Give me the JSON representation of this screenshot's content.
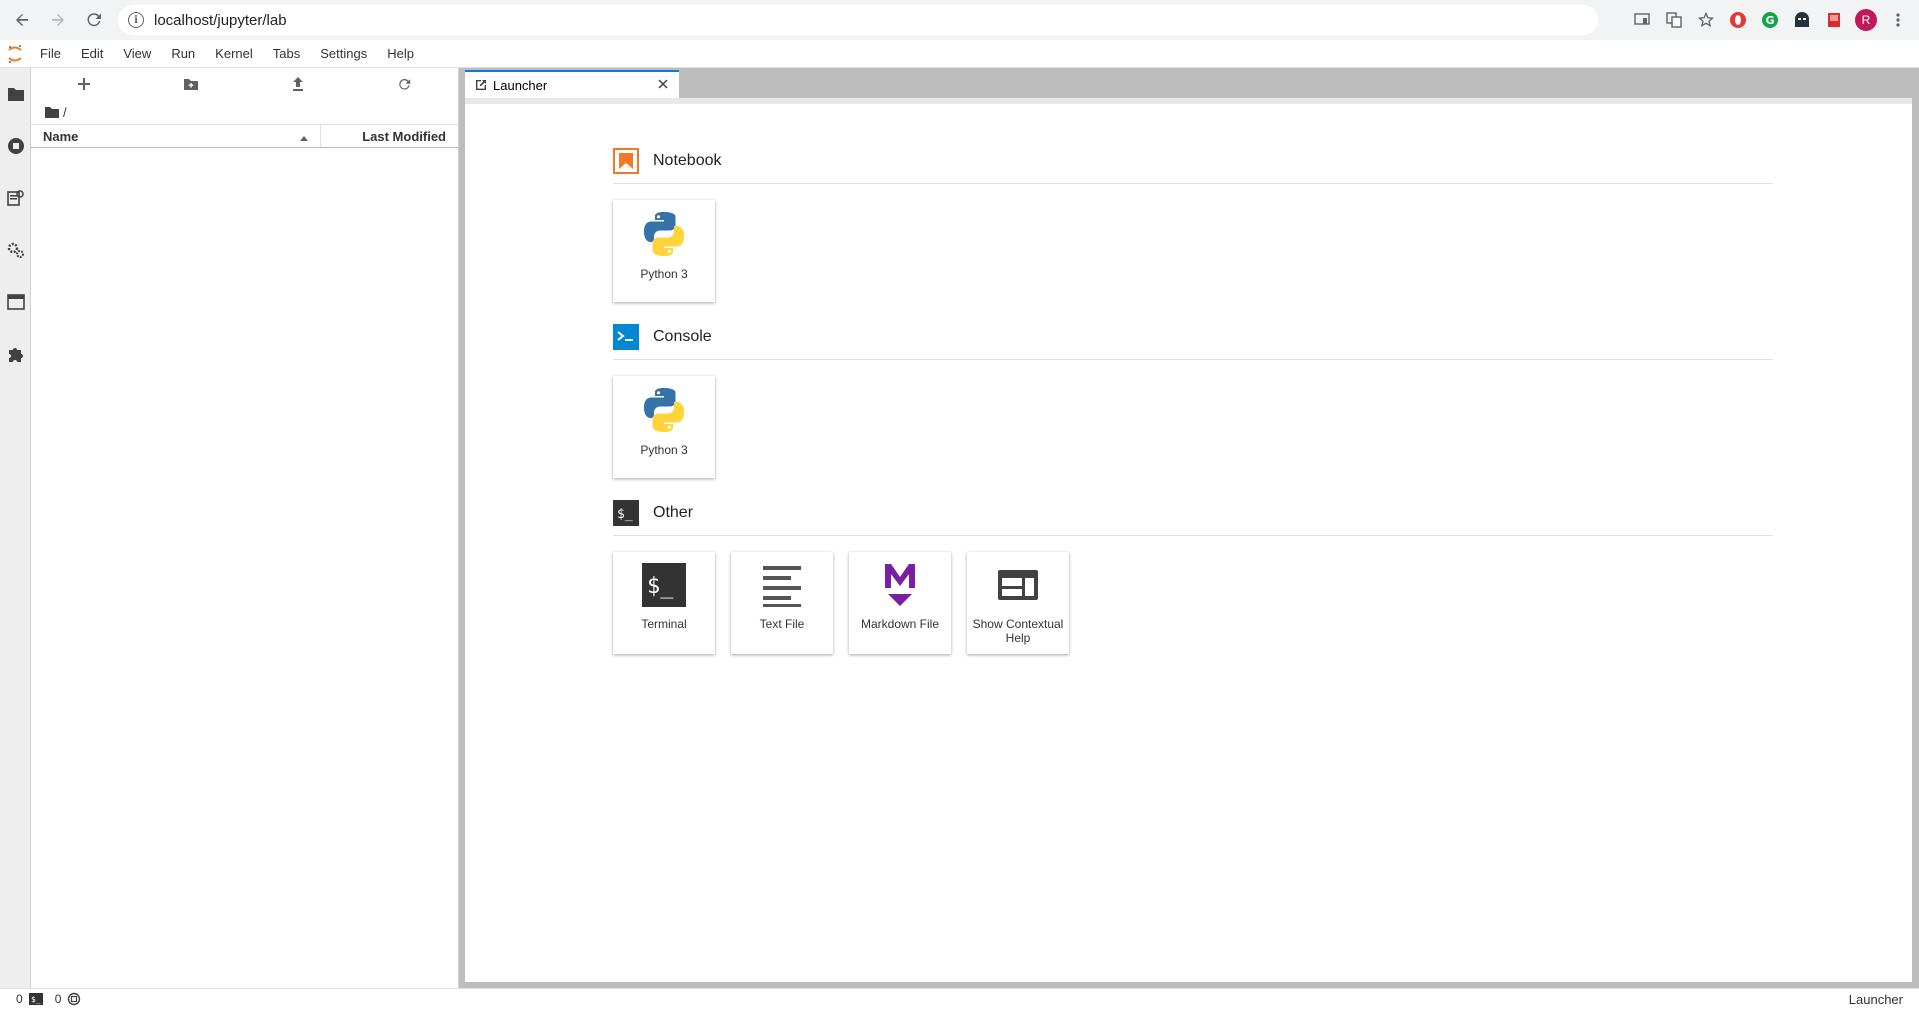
{
  "browser": {
    "url": "localhost/jupyter/lab",
    "avatar_letter": "R"
  },
  "menu": {
    "items": [
      "File",
      "Edit",
      "View",
      "Run",
      "Kernel",
      "Tabs",
      "Settings",
      "Help"
    ]
  },
  "filebrowser": {
    "breadcrumb": "/",
    "col_name": "Name",
    "col_modified": "Last Modified"
  },
  "tabs": [
    {
      "label": "Launcher"
    }
  ],
  "launcher": {
    "sections": [
      {
        "title": "Notebook",
        "cards": [
          {
            "label": "Python 3"
          }
        ]
      },
      {
        "title": "Console",
        "cards": [
          {
            "label": "Python 3"
          }
        ]
      },
      {
        "title": "Other",
        "cards": [
          {
            "label": "Terminal"
          },
          {
            "label": "Text File"
          },
          {
            "label": "Markdown File"
          },
          {
            "label": "Show Contextual Help"
          }
        ]
      }
    ]
  },
  "statusbar": {
    "kernels_count": "0",
    "terminals_count": "0",
    "mode": "Launcher"
  },
  "colors": {
    "accent": "#1976d2",
    "notebook_icon": "#f37726",
    "console_icon": "#0288d1",
    "markdown_icon": "#7b1fa2"
  }
}
